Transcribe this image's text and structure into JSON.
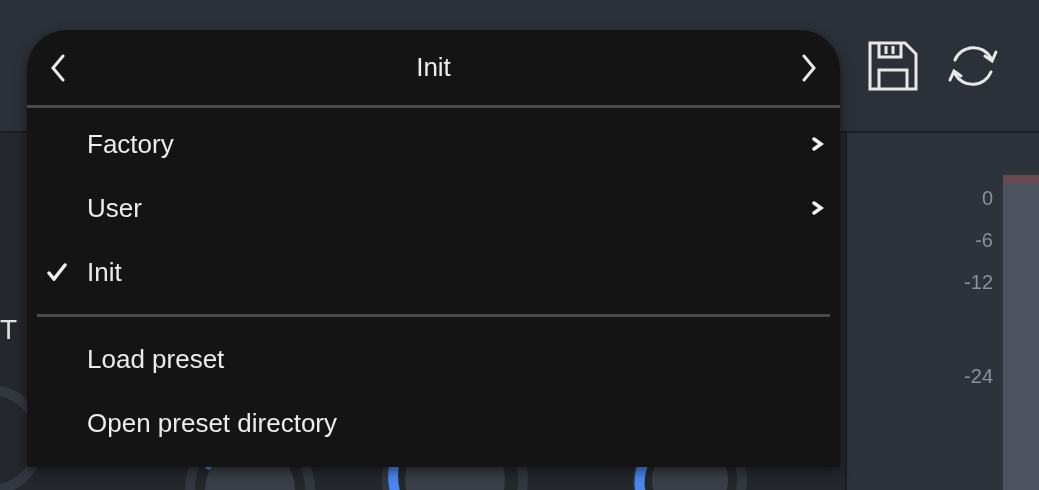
{
  "side_label": "T",
  "preset_menu": {
    "title": "Init",
    "items": [
      {
        "kind": "submenu",
        "label": "Factory",
        "checked": false
      },
      {
        "kind": "submenu",
        "label": "User",
        "checked": false
      },
      {
        "kind": "preset",
        "label": "Init",
        "checked": true
      },
      {
        "kind": "divider"
      },
      {
        "kind": "action",
        "label": "Load preset",
        "checked": false
      },
      {
        "kind": "action",
        "label": "Open preset directory",
        "checked": false
      }
    ]
  },
  "meter": {
    "scale": [
      "0",
      "-6",
      "-12",
      "-24"
    ]
  }
}
